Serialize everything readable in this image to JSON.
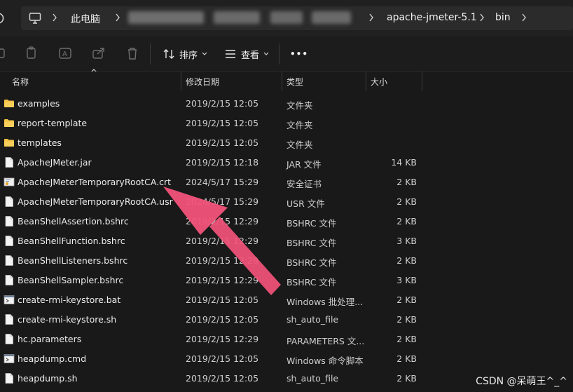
{
  "address": {
    "crumbs": [
      "此电脑",
      "apache-jmeter-5.1",
      "bin"
    ]
  },
  "toolbar": {
    "sort_label": "排序",
    "view_label": "查看",
    "more_label": "•••"
  },
  "columns": {
    "name": "名称",
    "date": "修改日期",
    "type": "类型",
    "size": "大小"
  },
  "files": [
    {
      "name": "examples",
      "date": "2019/2/15 12:05",
      "type": "文件夹",
      "size": "",
      "icon": "folder-icon"
    },
    {
      "name": "report-template",
      "date": "2019/2/15 12:05",
      "type": "文件夹",
      "size": "",
      "icon": "folder-icon"
    },
    {
      "name": "templates",
      "date": "2019/2/15 12:05",
      "type": "文件夹",
      "size": "",
      "icon": "folder-icon"
    },
    {
      "name": "ApacheJMeter.jar",
      "date": "2019/2/15 12:18",
      "type": "JAR 文件",
      "size": "14 KB",
      "icon": "file-icon"
    },
    {
      "name": "ApacheJMeterTemporaryRootCA.crt",
      "date": "2024/5/17 15:29",
      "type": "安全证书",
      "size": "2 KB",
      "icon": "certificate-icon"
    },
    {
      "name": "ApacheJMeterTemporaryRootCA.usr",
      "date": "2024/5/17 15:29",
      "type": "USR 文件",
      "size": "2 KB",
      "icon": "file-icon"
    },
    {
      "name": "BeanShellAssertion.bshrc",
      "date": "2019/2/15 12:29",
      "type": "BSHRC 文件",
      "size": "2 KB",
      "icon": "file-icon"
    },
    {
      "name": "BeanShellFunction.bshrc",
      "date": "2019/2/15 12:29",
      "type": "BSHRC 文件",
      "size": "3 KB",
      "icon": "file-icon"
    },
    {
      "name": "BeanShellListeners.bshrc",
      "date": "2019/2/15 12:29",
      "type": "BSHRC 文件",
      "size": "2 KB",
      "icon": "file-icon"
    },
    {
      "name": "BeanShellSampler.bshrc",
      "date": "2019/2/15 12:29",
      "type": "BSHRC 文件",
      "size": "3 KB",
      "icon": "file-icon"
    },
    {
      "name": "create-rmi-keystore.bat",
      "date": "2019/2/15 12:05",
      "type": "Windows 批处理...",
      "size": "2 KB",
      "icon": "script-icon"
    },
    {
      "name": "create-rmi-keystore.sh",
      "date": "2019/2/15 12:05",
      "type": "sh_auto_file",
      "size": "2 KB",
      "icon": "file-icon"
    },
    {
      "name": "hc.parameters",
      "date": "2019/2/15 12:29",
      "type": "PARAMETERS 文...",
      "size": "2 KB",
      "icon": "file-icon"
    },
    {
      "name": "heapdump.cmd",
      "date": "2019/2/15 12:05",
      "type": "Windows 命令脚本",
      "size": "2 KB",
      "icon": "script-icon"
    },
    {
      "name": "heapdump.sh",
      "date": "2019/2/15 12:05",
      "type": "sh_auto_file",
      "size": "2 KB",
      "icon": "file-icon"
    }
  ],
  "watermark": "CSDN @呆萌王^_^",
  "colors": {
    "background": "#191919",
    "arrow": "#f2527a",
    "folder": "#f5c242"
  }
}
